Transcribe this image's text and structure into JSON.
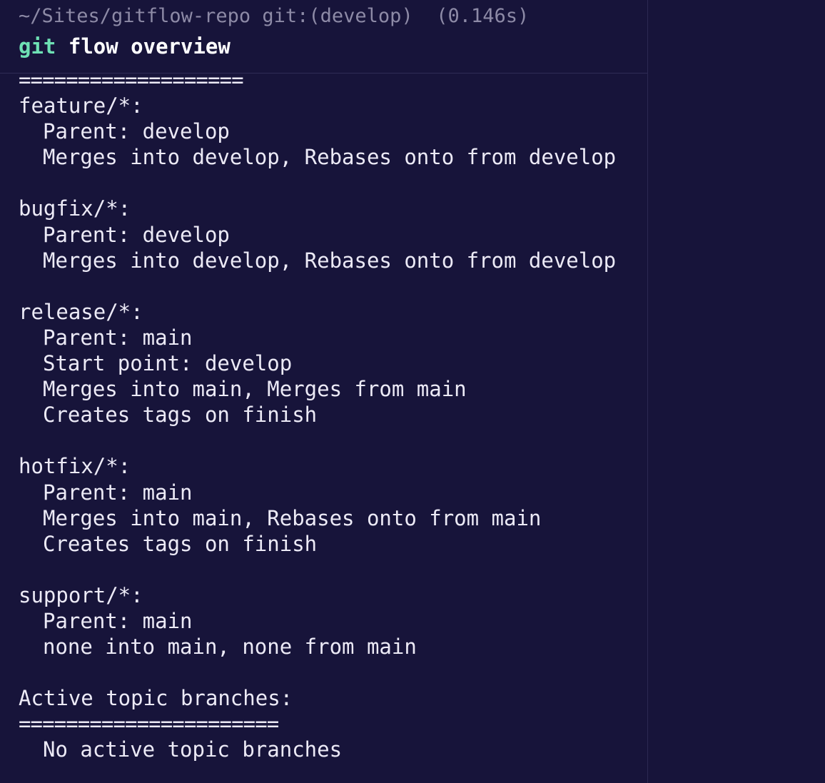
{
  "prompt": {
    "path": "~/Sites/gitflow-repo",
    "git_label": "git:(develop)",
    "duration": "(0.146s)"
  },
  "command": {
    "program": "git",
    "args": "flow overview"
  },
  "output": {
    "top_rule": "===================",
    "sections": [
      {
        "header": "feature/*:",
        "lines": [
          "Parent: develop",
          "Merges into develop, Rebases onto from develop"
        ]
      },
      {
        "header": "bugfix/*:",
        "lines": [
          "Parent: develop",
          "Merges into develop, Rebases onto from develop"
        ]
      },
      {
        "header": "release/*:",
        "lines": [
          "Parent: main",
          "Start point: develop",
          "Merges into main, Merges from main",
          "Creates tags on finish"
        ]
      },
      {
        "header": "hotfix/*:",
        "lines": [
          "Parent: main",
          "Merges into main, Rebases onto from main",
          "Creates tags on finish"
        ]
      },
      {
        "header": "support/*:",
        "lines": [
          "Parent: main",
          "none into main, none from main"
        ]
      }
    ],
    "active_header": "Active topic branches:",
    "active_rule": "======================",
    "active_message": "No active topic branches"
  },
  "colors": {
    "background": "#17143a",
    "command_git": "#6ee0b4",
    "prompt_text": "#8d8aa6",
    "output_text": "#eceaf6"
  }
}
